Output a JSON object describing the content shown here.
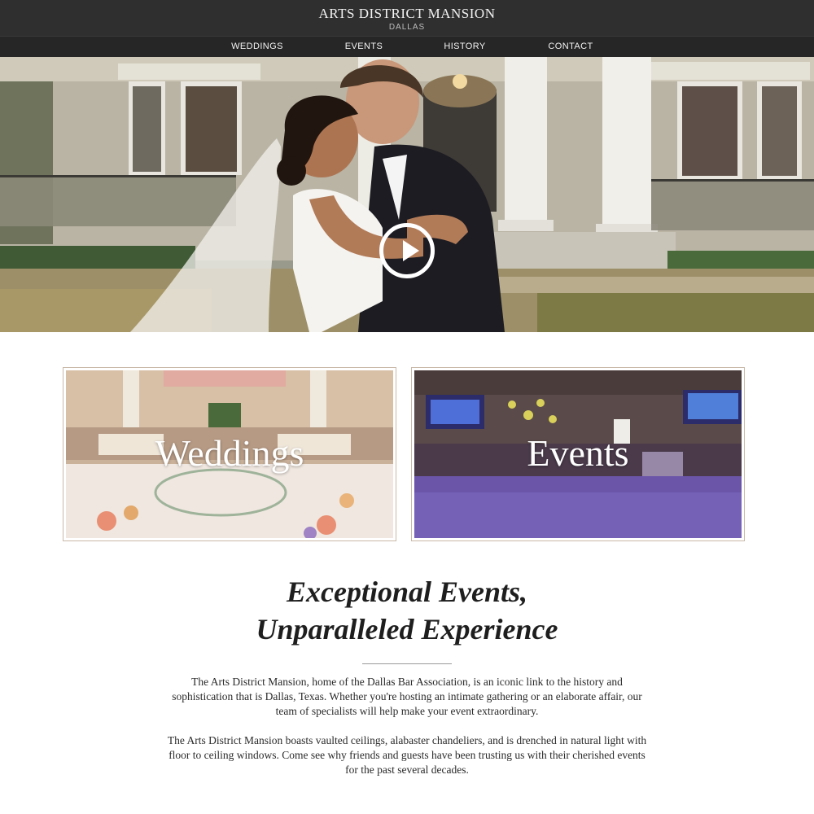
{
  "header": {
    "brand_name": "ARTS DISTRICT MANSION",
    "brand_location": "DALLAS",
    "nav": [
      {
        "label": "WEDDINGS"
      },
      {
        "label": "EVENTS"
      },
      {
        "label": "HISTORY"
      },
      {
        "label": "CONTACT"
      }
    ]
  },
  "hero": {
    "play_icon": "play-icon"
  },
  "cards": [
    {
      "label": "Weddings"
    },
    {
      "label": "Events"
    }
  ],
  "intro": {
    "headline_line1": "Exceptional Events,",
    "headline_line2": "Unparalleled Experience",
    "paragraph1": "The Arts District Mansion, home of the Dallas Bar Association, is an iconic link to the history and sophistication that is Dallas, Texas. Whether you're hosting an intimate gathering or an elaborate affair, our team of specialists will help make your event extraordinary.",
    "paragraph2": "The Arts District Mansion boasts vaulted ceilings, alabaster chandeliers, and is drenched in natural light with floor to ceiling windows. Come see why friends and guests have been trusting us with their cherished events for the past several decades."
  },
  "colors": {
    "header_bg": "#2f2f2f",
    "nav_bg": "#262626",
    "card_border": "#c9b8a8",
    "text": "#1e1e1e"
  }
}
